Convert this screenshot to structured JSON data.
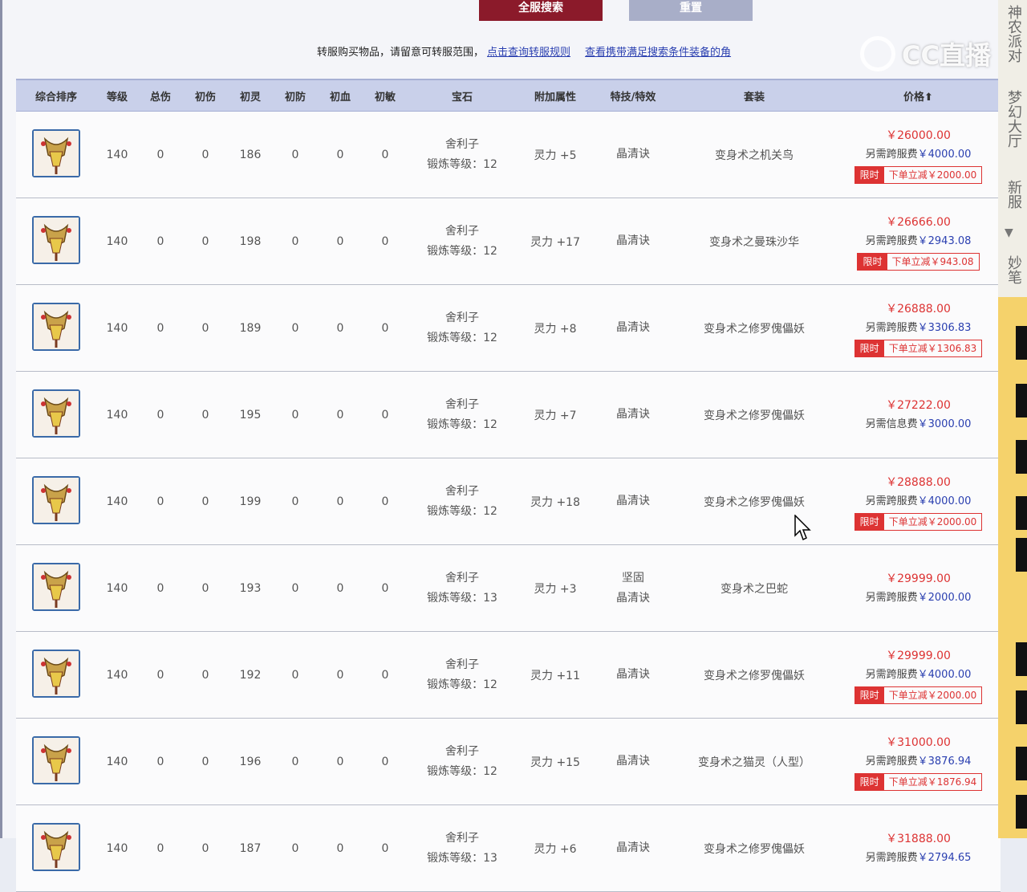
{
  "buttons": {
    "search": "全服搜索",
    "reset": "重置"
  },
  "notice": {
    "text": "转服购买物品，请留意可转服范围，",
    "link1": "点击查询转服规则",
    "link2": "查看携带满足搜索条件装备的角"
  },
  "headers": [
    "综合排序",
    "等级",
    "总伤",
    "初伤",
    "初灵",
    "初防",
    "初血",
    "初敏",
    "宝石",
    "附加属性",
    "特技/特效",
    "套装",
    "价格"
  ],
  "sort_arrow": "⬆",
  "rows": [
    {
      "level": "140",
      "c1": "0",
      "c2": "0",
      "c3": "186",
      "c4": "0",
      "c5": "0",
      "c6": "0",
      "gem": "舍利子",
      "forge": "锻炼等级：12",
      "attr": "灵力 +5",
      "eff": [
        "晶清诀"
      ],
      "set": "变身术之机关鸟",
      "price": "￥26000.00",
      "fee_label": "另需跨服费",
      "fee": "￥4000.00",
      "limited": true,
      "limit_tag": "限时",
      "discount": "下单立减￥2000.00"
    },
    {
      "level": "140",
      "c1": "0",
      "c2": "0",
      "c3": "198",
      "c4": "0",
      "c5": "0",
      "c6": "0",
      "gem": "舍利子",
      "forge": "锻炼等级：12",
      "attr": "灵力 +17",
      "eff": [
        "晶清诀"
      ],
      "set": "变身术之曼珠沙华",
      "price": "￥26666.00",
      "fee_label": "另需跨服费",
      "fee": "￥2943.08",
      "limited": true,
      "limit_tag": "限时",
      "discount": "下单立减￥943.08"
    },
    {
      "level": "140",
      "c1": "0",
      "c2": "0",
      "c3": "189",
      "c4": "0",
      "c5": "0",
      "c6": "0",
      "gem": "舍利子",
      "forge": "锻炼等级：12",
      "attr": "灵力 +8",
      "eff": [
        "晶清诀"
      ],
      "set": "变身术之修罗傀儡妖",
      "price": "￥26888.00",
      "fee_label": "另需跨服费",
      "fee": "￥3306.83",
      "limited": true,
      "limit_tag": "限时",
      "discount": "下单立减￥1306.83"
    },
    {
      "level": "140",
      "c1": "0",
      "c2": "0",
      "c3": "195",
      "c4": "0",
      "c5": "0",
      "c6": "0",
      "gem": "舍利子",
      "forge": "锻炼等级：12",
      "attr": "灵力 +7",
      "eff": [
        "晶清诀"
      ],
      "set": "变身术之修罗傀儡妖",
      "price": "￥27222.00",
      "fee_label": "另需信息费",
      "fee": "￥3000.00",
      "limited": false
    },
    {
      "level": "140",
      "c1": "0",
      "c2": "0",
      "c3": "199",
      "c4": "0",
      "c5": "0",
      "c6": "0",
      "gem": "舍利子",
      "forge": "锻炼等级：12",
      "attr": "灵力 +18",
      "eff": [
        "晶清诀"
      ],
      "set": "变身术之修罗傀儡妖",
      "price": "￥28888.00",
      "fee_label": "另需跨服费",
      "fee": "￥4000.00",
      "limited": true,
      "limit_tag": "限时",
      "discount": "下单立减￥2000.00"
    },
    {
      "level": "140",
      "c1": "0",
      "c2": "0",
      "c3": "193",
      "c4": "0",
      "c5": "0",
      "c6": "0",
      "gem": "舍利子",
      "forge": "锻炼等级：13",
      "attr": "灵力 +3",
      "eff": [
        "坚固",
        "晶清诀"
      ],
      "set": "变身术之巴蛇",
      "price": "￥29999.00",
      "fee_label": "另需跨服费",
      "fee": "￥2000.00",
      "limited": false
    },
    {
      "level": "140",
      "c1": "0",
      "c2": "0",
      "c3": "192",
      "c4": "0",
      "c5": "0",
      "c6": "0",
      "gem": "舍利子",
      "forge": "锻炼等级：12",
      "attr": "灵力 +11",
      "eff": [
        "晶清诀"
      ],
      "set": "变身术之修罗傀儡妖",
      "price": "￥29999.00",
      "fee_label": "另需跨服费",
      "fee": "￥4000.00",
      "limited": true,
      "limit_tag": "限时",
      "discount": "下单立减￥2000.00"
    },
    {
      "level": "140",
      "c1": "0",
      "c2": "0",
      "c3": "196",
      "c4": "0",
      "c5": "0",
      "c6": "0",
      "gem": "舍利子",
      "forge": "锻炼等级：12",
      "attr": "灵力 +15",
      "eff": [
        "晶清诀"
      ],
      "set": "变身术之猫灵（人型）",
      "price": "￥31000.00",
      "fee_label": "另需跨服费",
      "fee": "￥3876.94",
      "limited": true,
      "limit_tag": "限时",
      "discount": "下单立减￥1876.94"
    },
    {
      "level": "140",
      "c1": "0",
      "c2": "0",
      "c3": "187",
      "c4": "0",
      "c5": "0",
      "c6": "0",
      "gem": "舍利子",
      "forge": "锻炼等级：13",
      "attr": "灵力 +6",
      "eff": [
        "晶清诀"
      ],
      "set": "变身术之修罗傀儡妖",
      "price": "￥31888.00",
      "fee_label": "另需跨服费",
      "fee": "￥2794.65",
      "limited": false
    }
  ],
  "side_panel": [
    "神农派对",
    "梦幻大厅",
    "新服",
    "妙笔"
  ],
  "watermark": "CC直播",
  "colors": {
    "header_bg": "#c9d0ea",
    "price_red": "#dd3333",
    "link_blue": "#2a3fb0",
    "search_btn": "#8b1a2a"
  }
}
